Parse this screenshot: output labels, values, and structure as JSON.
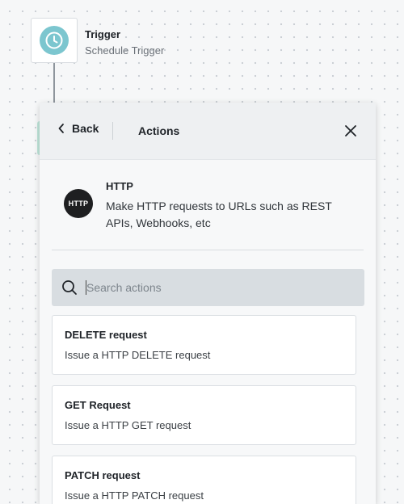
{
  "trigger": {
    "title": "Trigger",
    "subtitle": "Schedule Trigger",
    "icon": "clock-icon"
  },
  "panel": {
    "back_label": "Back",
    "title": "Actions"
  },
  "app": {
    "logo_text": "HTTP",
    "name": "HTTP",
    "description": "Make HTTP requests to URLs such as REST APIs, Webhooks, etc"
  },
  "search": {
    "placeholder": "Search actions",
    "value": ""
  },
  "actions": [
    {
      "title": "DELETE request",
      "description": "Issue a HTTP DELETE request"
    },
    {
      "title": "GET Request",
      "description": "Issue a HTTP GET request"
    },
    {
      "title": "PATCH request",
      "description": "Issue a HTTP PATCH request"
    }
  ],
  "colors": {
    "accent": "#7cc6cf",
    "logo_bg": "#1e1f21"
  }
}
